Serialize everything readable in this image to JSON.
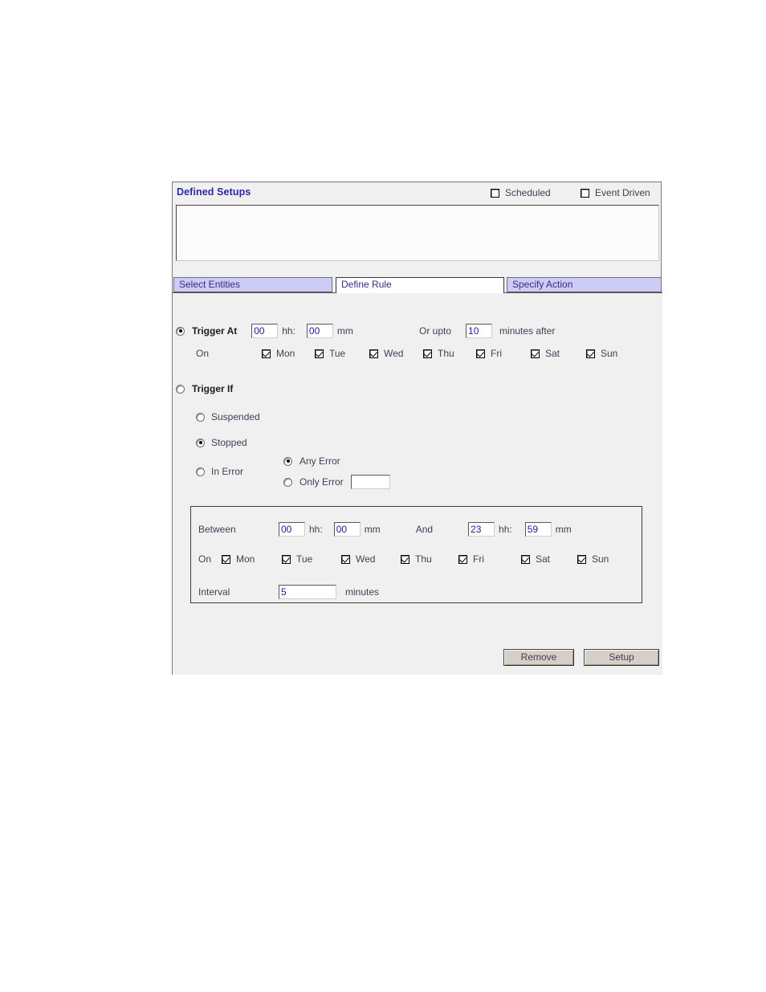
{
  "panel": {
    "defined_setups_label": "Defined Setups",
    "header_checkboxes": [
      {
        "label": "Scheduled",
        "checked": false,
        "name": "scheduled"
      },
      {
        "label": "Event Driven",
        "checked": false,
        "name": "event-driven"
      }
    ],
    "listbox": {
      "items": [],
      "empty": ""
    }
  },
  "tabs": [
    {
      "label": "Select Entities",
      "active": false
    },
    {
      "label": "Define Rule",
      "active": true
    },
    {
      "label": "Specify Action",
      "active": false
    }
  ],
  "define_rule": {
    "trigger_at": {
      "label": "Trigger At",
      "selected": true,
      "hh_value": "00",
      "mm_value": "00",
      "hh_unit": "hh:",
      "mm_unit": "mm",
      "or_upto_label": "Or upto",
      "or_upto_value": "10",
      "minutes_after_label": "minutes after",
      "on_label": "On",
      "days": [
        {
          "label": "Mon",
          "checked": true
        },
        {
          "label": "Tue",
          "checked": true
        },
        {
          "label": "Wed",
          "checked": true
        },
        {
          "label": "Thu",
          "checked": true
        },
        {
          "label": "Fri",
          "checked": true
        },
        {
          "label": "Sat",
          "checked": true
        },
        {
          "label": "Sun",
          "checked": true
        }
      ]
    },
    "trigger_if": {
      "label": "Trigger If",
      "selected": false,
      "options": [
        {
          "label": "Suspended",
          "selected": false
        },
        {
          "label": "Stopped",
          "selected": true
        },
        {
          "label": "In Error",
          "selected": false
        }
      ],
      "error_options": [
        {
          "label": "Any Error",
          "selected": true
        },
        {
          "label": "Only Error",
          "selected": false
        }
      ],
      "only_error_value": ""
    },
    "schedule_box": {
      "between_label": "Between",
      "from_hh": "00",
      "from_mm": "00",
      "and_label": "And",
      "to_hh": "23",
      "to_mm": "59",
      "hh_unit": "hh:",
      "mm_unit": "mm",
      "on_label": "On",
      "days": [
        {
          "label": "Mon",
          "checked": true
        },
        {
          "label": "Tue",
          "checked": true
        },
        {
          "label": "Wed",
          "checked": true
        },
        {
          "label": "Thu",
          "checked": true
        },
        {
          "label": "Fri",
          "checked": true
        },
        {
          "label": "Sat",
          "checked": true
        },
        {
          "label": "Sun",
          "checked": true
        }
      ],
      "interval_label": "Interval",
      "interval_value": "5",
      "interval_unit": "minutes"
    }
  },
  "buttons": {
    "remove": "Remove",
    "setup": "Setup"
  },
  "colors": {
    "tab_inactive_bg": "#ccccf5",
    "tab_text": "#3a2a88",
    "heading_text": "#2a2aa8",
    "body_text": "#4a3a55",
    "panel_bg": "#f0f0f0",
    "input_text": "#1d1d9a",
    "button_bg": "#d4d0c8"
  }
}
